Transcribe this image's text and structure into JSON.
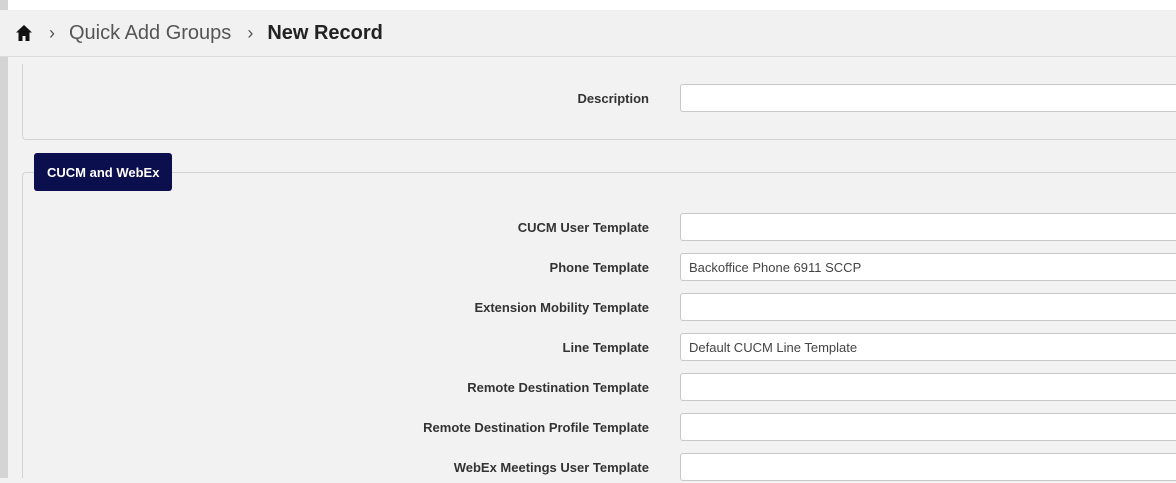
{
  "breadcrumb": {
    "home_icon": "home-icon",
    "items": [
      "Quick Add Groups",
      "New Record"
    ]
  },
  "description": {
    "label": "Description",
    "value": ""
  },
  "cucm_section": {
    "legend": "CUCM and WebEx",
    "fields": [
      {
        "label": "CUCM User Template",
        "value": ""
      },
      {
        "label": "Phone Template",
        "value": "Backoffice Phone 6911 SCCP"
      },
      {
        "label": "Extension Mobility Template",
        "value": ""
      },
      {
        "label": "Line Template",
        "value": "Default CUCM Line Template"
      },
      {
        "label": "Remote Destination Template",
        "value": ""
      },
      {
        "label": "Remote Destination Profile Template",
        "value": ""
      },
      {
        "label": "WebEx Meetings User Template",
        "value": ""
      }
    ]
  },
  "colors": {
    "legend_bg": "#0c0f4e",
    "page_bg": "#f2f2f2"
  }
}
